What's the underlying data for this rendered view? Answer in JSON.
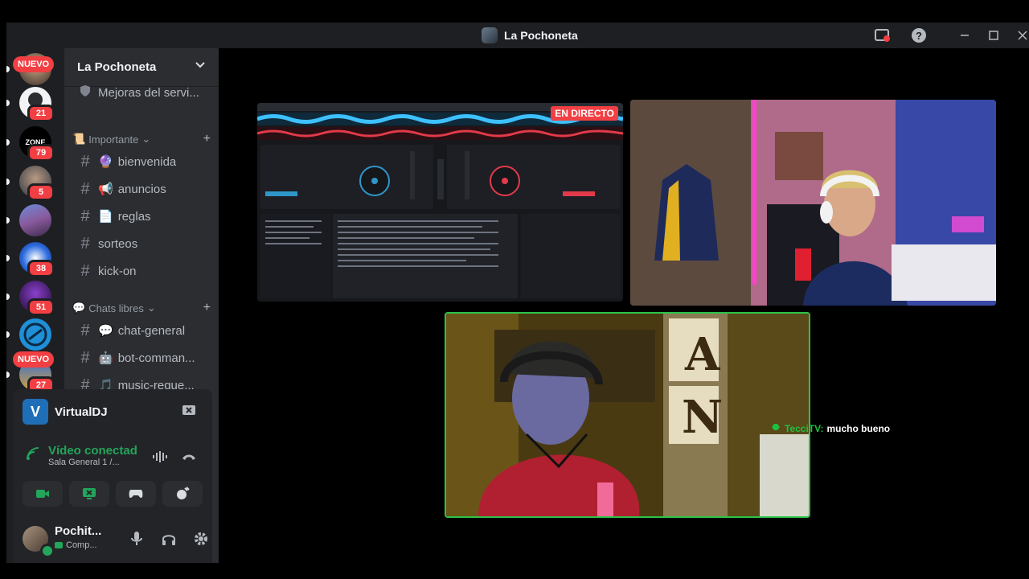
{
  "window": {
    "title": "La Pochoneta"
  },
  "servers": [
    {
      "badge": ""
    },
    {
      "badge": "21"
    },
    {
      "badge": "79",
      "logo_text": "ZONE"
    },
    {
      "badge": "5"
    },
    {
      "badge": ""
    },
    {
      "badge": "38"
    },
    {
      "badge": "51"
    },
    {
      "badge": ""
    },
    {
      "badge": "27"
    }
  ],
  "new_labels": [
    "NUEVO",
    "NUEVO"
  ],
  "sidebar": {
    "server_name": "La Pochoneta",
    "top_channel": "Mejoras del servi...",
    "category_important": "Importante",
    "important_channels": [
      {
        "prefix": "🔮",
        "label": "bienvenida"
      },
      {
        "prefix": "📢",
        "label": "anuncios"
      },
      {
        "prefix": "📄",
        "label": "reglas"
      },
      {
        "prefix": "",
        "label": "sorteos"
      },
      {
        "prefix": "",
        "label": "kick-on"
      }
    ],
    "category_chats": "Chats libres",
    "chat_channels": [
      {
        "prefix": "💬",
        "label": "chat-general"
      },
      {
        "prefix": "🤖",
        "label": "bot-comman..."
      },
      {
        "prefix": "🎵",
        "label": "music-reque..."
      }
    ]
  },
  "voice": {
    "activity_name": "VirtualDJ",
    "activity_logo": "V",
    "status": "Vídeo conectad",
    "channel": "Sala General 1 /...",
    "user_name": "Pochit...",
    "user_status": "Comp..."
  },
  "stage": {
    "live_label": "EN DIRECTO",
    "chat_user": "TecciTV:",
    "chat_message": "mucho bueno",
    "tile_letters": [
      "A",
      "N"
    ]
  },
  "colors": {
    "accent_green": "#23a55a",
    "live_red": "#f23f43",
    "rail_bg": "#1e1f22",
    "sidebar_bg": "#2b2d31"
  }
}
